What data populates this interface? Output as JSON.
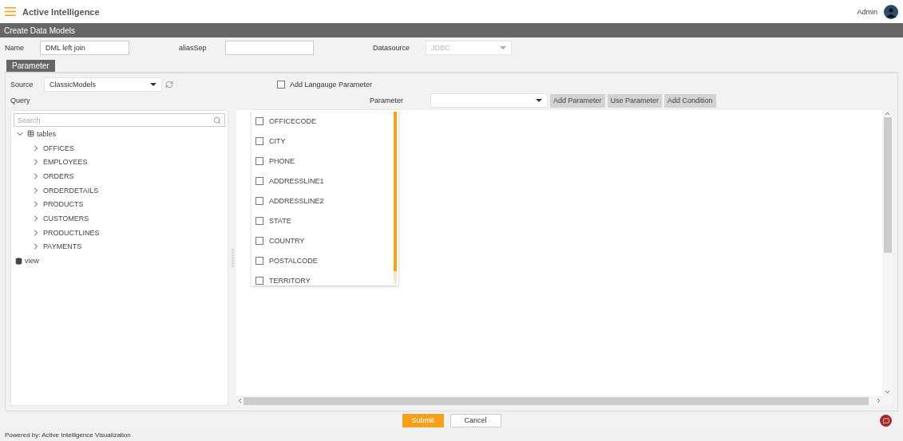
{
  "app": {
    "title": "Active Intelligence",
    "user": "Admin"
  },
  "page_title": "Create Data Models",
  "form": {
    "name_label": "Name",
    "name_value": "DML left join",
    "alias_label": "aliasSep",
    "datasource_label": "Datasource",
    "datasource_value": "JDBC",
    "datasource_disabled": true
  },
  "tabs": [
    {
      "label": "Parameter",
      "selected": true
    }
  ],
  "source": {
    "label": "Source",
    "value": "ClassicModels"
  },
  "language_param": {
    "label": "Add Langauge Parameter",
    "checked": false
  },
  "query_label": "Query",
  "parameter": {
    "label": "Parameter"
  },
  "buttons": [
    "Add Parameter",
    "Use Parameter",
    "Add Condition"
  ],
  "tree": {
    "search_placeholder": "Search",
    "nodes": [
      {
        "label": "tables",
        "kind": "table",
        "expanded": true,
        "children": [
          {
            "label": "OFFICES",
            "expanded": false
          },
          {
            "label": "EMPLOYEES",
            "expanded": false
          },
          {
            "label": "ORDERS",
            "expanded": false
          },
          {
            "label": "ORDERDETAILS",
            "expanded": false
          },
          {
            "label": "PRODUCTS",
            "expanded": false
          },
          {
            "label": "CUSTOMERS",
            "expanded": false
          },
          {
            "label": "PRODUCTLINES",
            "expanded": false
          },
          {
            "label": "PAYMENTS",
            "expanded": false
          }
        ]
      },
      {
        "label": "view",
        "kind": "database"
      }
    ]
  },
  "column_list": [
    {
      "label": "OFFICECODE",
      "checked": false
    },
    {
      "label": "CITY",
      "checked": false
    },
    {
      "label": "PHONE",
      "checked": false
    },
    {
      "label": "ADDRESSLINE1",
      "checked": false
    },
    {
      "label": "ADDRESSLINE2",
      "checked": false
    },
    {
      "label": "STATE",
      "checked": false
    },
    {
      "label": "COUNTRY",
      "checked": false
    },
    {
      "label": "POSTALCODE",
      "checked": false
    },
    {
      "label": "TERRITORY",
      "checked": false
    }
  ],
  "actions": [
    {
      "label": "Submit",
      "kind": "primary"
    },
    {
      "label": "Cancel",
      "kind": "secondary"
    }
  ],
  "footer": "Powered by: Active Intelligence Visualization"
}
